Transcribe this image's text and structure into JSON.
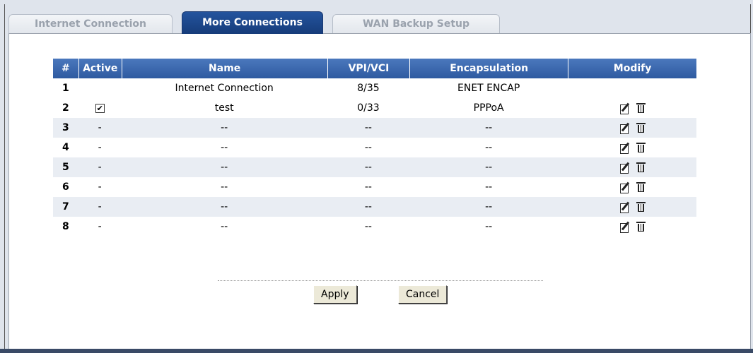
{
  "tabs": [
    {
      "label": "Internet Connection"
    },
    {
      "label": "More Connections"
    },
    {
      "label": "WAN Backup Setup"
    }
  ],
  "table": {
    "headers": [
      "#",
      "Active",
      "Name",
      "VPI/VCI",
      "Encapsulation",
      "Modify"
    ],
    "rows": [
      {
        "num": "1",
        "active": "",
        "name": "Internet Connection",
        "vpivci": "8/35",
        "encap": "ENET ENCAP"
      },
      {
        "num": "2",
        "active": "✔",
        "name": "test",
        "vpivci": "0/33",
        "encap": "PPPoA"
      },
      {
        "num": "3",
        "active": "-",
        "name": "--",
        "vpivci": "--",
        "encap": "--"
      },
      {
        "num": "4",
        "active": "-",
        "name": "--",
        "vpivci": "--",
        "encap": "--"
      },
      {
        "num": "5",
        "active": "-",
        "name": "--",
        "vpivci": "--",
        "encap": "--"
      },
      {
        "num": "6",
        "active": "-",
        "name": "--",
        "vpivci": "--",
        "encap": "--"
      },
      {
        "num": "7",
        "active": "-",
        "name": "--",
        "vpivci": "--",
        "encap": "--"
      },
      {
        "num": "8",
        "active": "-",
        "name": "--",
        "vpivci": "--",
        "encap": "--"
      }
    ]
  },
  "buttons": {
    "apply": "Apply",
    "cancel": "Cancel"
  },
  "colors": {
    "header": "#2e5aa0",
    "active_tab": "#1f4a8e",
    "alt_row": "#e9edf3"
  }
}
